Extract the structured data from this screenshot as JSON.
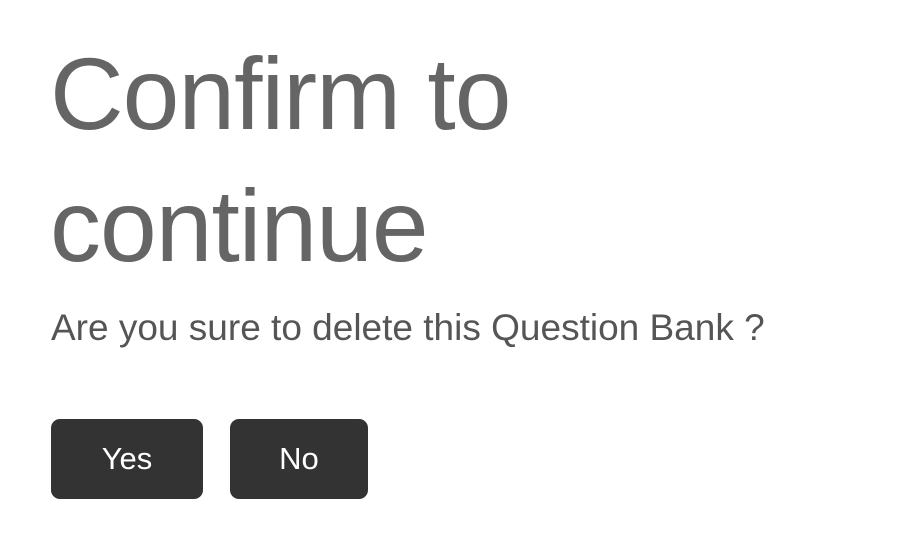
{
  "dialog": {
    "title": "Confirm to continue",
    "message": "Are you sure to delete this Question Bank ?",
    "buttons": {
      "yes_label": "Yes",
      "no_label": "No"
    }
  },
  "colors": {
    "title_text": "#656565",
    "message_text": "#555555",
    "button_background": "#333333",
    "button_text": "#ffffff"
  }
}
